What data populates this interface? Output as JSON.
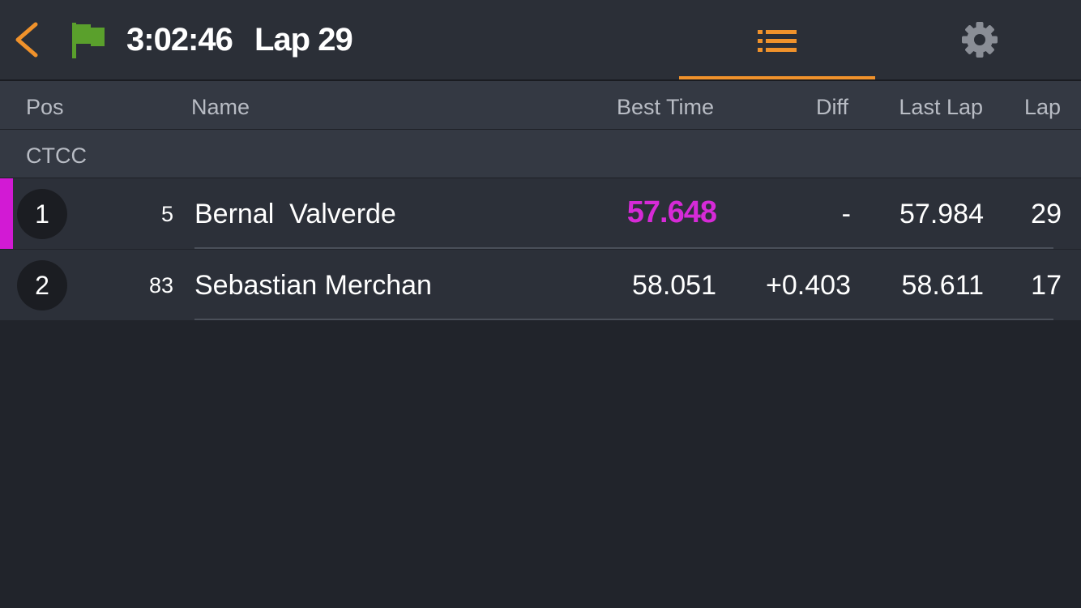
{
  "header": {
    "clock": "3:02:46",
    "lap_title": "Lap 29",
    "back_icon": "chevron-left-icon",
    "flag_icon": "green-flag-icon",
    "flag_color": "#5aa02c",
    "accent_color": "#f0922b",
    "tabs": [
      {
        "name": "list",
        "icon": "list-icon",
        "active": true
      },
      {
        "name": "settings",
        "icon": "gear-icon",
        "active": false
      }
    ]
  },
  "columns": {
    "pos": "Pos",
    "name": "Name",
    "best_time": "Best Time",
    "diff": "Diff",
    "last_lap": "Last Lap",
    "lap": "Lap"
  },
  "group": {
    "label": "CTCC"
  },
  "rows": [
    {
      "pos": "1",
      "car_number": "5",
      "driver": "Bernal  Valverde",
      "best_time": "57.648",
      "best_is_fastest": true,
      "diff": "-",
      "last_lap": "57.984",
      "lap": "29"
    },
    {
      "pos": "2",
      "car_number": "83",
      "driver": "Sebastian Merchan",
      "best_time": "58.051",
      "best_is_fastest": false,
      "diff": "+0.403",
      "last_lap": "58.611",
      "lap": "17"
    }
  ],
  "colors": {
    "fastest_lap": "#d62ad7",
    "leader_bar": "#d21ad4"
  }
}
